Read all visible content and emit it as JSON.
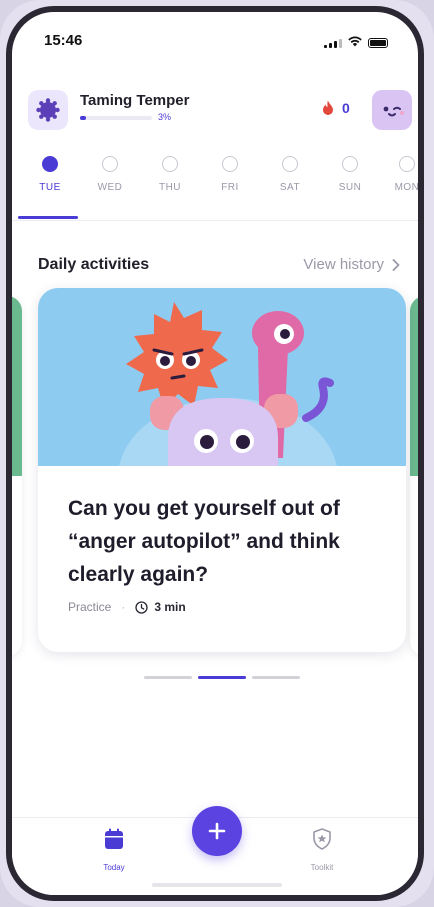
{
  "status_bar": {
    "time": "15:46"
  },
  "header": {
    "program_title": "Taming Temper",
    "progress_value": 0.03,
    "progress_label": "3%",
    "streak_count": "0"
  },
  "days": [
    {
      "label": "TUE",
      "active": true
    },
    {
      "label": "WED",
      "active": false
    },
    {
      "label": "THU",
      "active": false
    },
    {
      "label": "FRI",
      "active": false
    },
    {
      "label": "SAT",
      "active": false
    },
    {
      "label": "SUN",
      "active": false
    },
    {
      "label": "MON",
      "active": false
    }
  ],
  "section": {
    "title": "Daily activities",
    "view_history": "View history"
  },
  "card": {
    "title": "Can you get yourself out of “anger autopilot” and think clearly again?",
    "type": "Practice",
    "separator": "·",
    "duration": "3 min"
  },
  "carousel": {
    "pages": 3,
    "current": 1
  },
  "bottom_nav": {
    "today_label": "Today",
    "toolkit_label": "Toolkit"
  },
  "colors": {
    "accent": "#4a3bd4",
    "card_illustration_bg": "#8ecbf0",
    "streak_flame": "#e2483b",
    "peek_card": "#6bb98f"
  },
  "icons": {
    "program": "germ-blob-icon",
    "streak": "flame-icon",
    "avatar": "winking-face-icon",
    "view_history": "chevron-right-icon",
    "duration": "clock-icon",
    "today": "calendar-icon",
    "add": "plus-icon",
    "toolkit": "shield-star-icon"
  }
}
